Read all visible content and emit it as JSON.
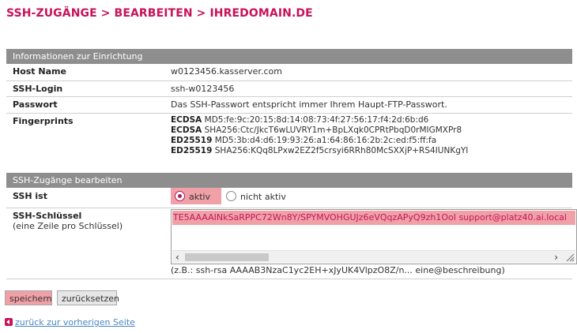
{
  "breadcrumb": "SSH-ZUGÄNGE > BEARBEITEN > IHREDOMAIN.DE",
  "info_section": {
    "title": "Informationen zur Einrichtung",
    "host_name": {
      "label": "Host Name",
      "value": "w0123456.kasserver.com"
    },
    "ssh_login": {
      "label": "SSH-Login",
      "value": "ssh-w0123456"
    },
    "password": {
      "label": "Passwort",
      "value": "Das SSH-Passwort entspricht immer Ihrem Haupt-FTP-Passwort."
    },
    "fingerprints": {
      "label": "Fingerprints",
      "entries": [
        {
          "algo": "ECDSA",
          "value": "MD5:fe:9c:20:15:8d:14:08:73:4f:27:56:17:f4:2d:6b:d6"
        },
        {
          "algo": "ECDSA",
          "value": "SHA256:Ctc/JkcT6wLUVRY1m+BpLXqk0CPRtPbqD0rMIGMXPr8"
        },
        {
          "algo": "ED25519",
          "value": "MD5:3b:d4:d6:19:93:26:a1:64:86:16:2b:2c:ed:f5:ff:fa"
        },
        {
          "algo": "ED25519",
          "value": "SHA256:KQq8LPxw2EZ2f5crsyi6RRh80McSXXjP+RS4IUNKgYI"
        }
      ]
    }
  },
  "edit_section": {
    "title": "SSH-Zugänge bearbeiten",
    "ssh_status": {
      "label": "SSH ist",
      "option_active": "aktiv",
      "option_inactive": "nicht aktiv",
      "selected": "aktiv"
    },
    "ssh_keys": {
      "label": "SSH-Schlüssel",
      "sublabel": "(eine Zeile pro Schlüssel)",
      "value": "TE5AAAAINkSaRPPC72Wn8Y/SPYMVOHGUJz6eVQqzAPyQ9zh1OoI support@platz40.ai.local",
      "hint": "(z.B.: ssh-rsa AAAAB3NzaC1yc2EH+xJyUK4VlpzO8Z/n... eine@beschreibung)"
    }
  },
  "buttons": {
    "save": "speichern",
    "reset": "zurücksetzen"
  },
  "back_link": "zurück zur vorherigen Seite",
  "colors": {
    "accent": "#c8125a",
    "highlight": "#f0a0a7",
    "header_bg": "#8e8e8e",
    "link": "#4a86c5"
  }
}
